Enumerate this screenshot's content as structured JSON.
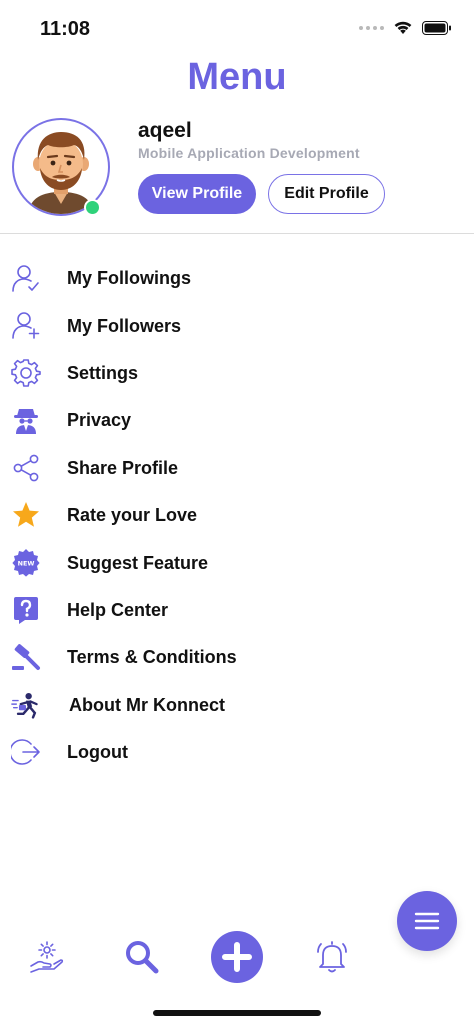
{
  "status_bar": {
    "time": "11:08"
  },
  "header": {
    "title": "Menu"
  },
  "profile": {
    "name": "aqeel",
    "subtitle": "Mobile Application Development",
    "view_label": "View Profile",
    "edit_label": "Edit Profile"
  },
  "menu": {
    "items": [
      {
        "label": "My Followings",
        "icon": "user-check-icon"
      },
      {
        "label": "My Followers",
        "icon": "user-plus-icon"
      },
      {
        "label": "Settings",
        "icon": "gear-icon"
      },
      {
        "label": "Privacy",
        "icon": "spy-icon"
      },
      {
        "label": "Share Profile",
        "icon": "share-icon"
      },
      {
        "label": "Rate your Love",
        "icon": "star-icon"
      },
      {
        "label": "Suggest Feature",
        "icon": "new-badge-icon"
      },
      {
        "label": "Help Center",
        "icon": "question-icon"
      },
      {
        "label": "Terms & Conditions",
        "icon": "gavel-icon"
      },
      {
        "label": "About Mr Konnect",
        "icon": "runner-icon"
      },
      {
        "label": "Logout",
        "icon": "logout-icon"
      }
    ]
  },
  "colors": {
    "accent": "#6b63e0",
    "subtitle": "#a7a9b4",
    "online": "#2fd27a",
    "star": "#f7a81b"
  }
}
